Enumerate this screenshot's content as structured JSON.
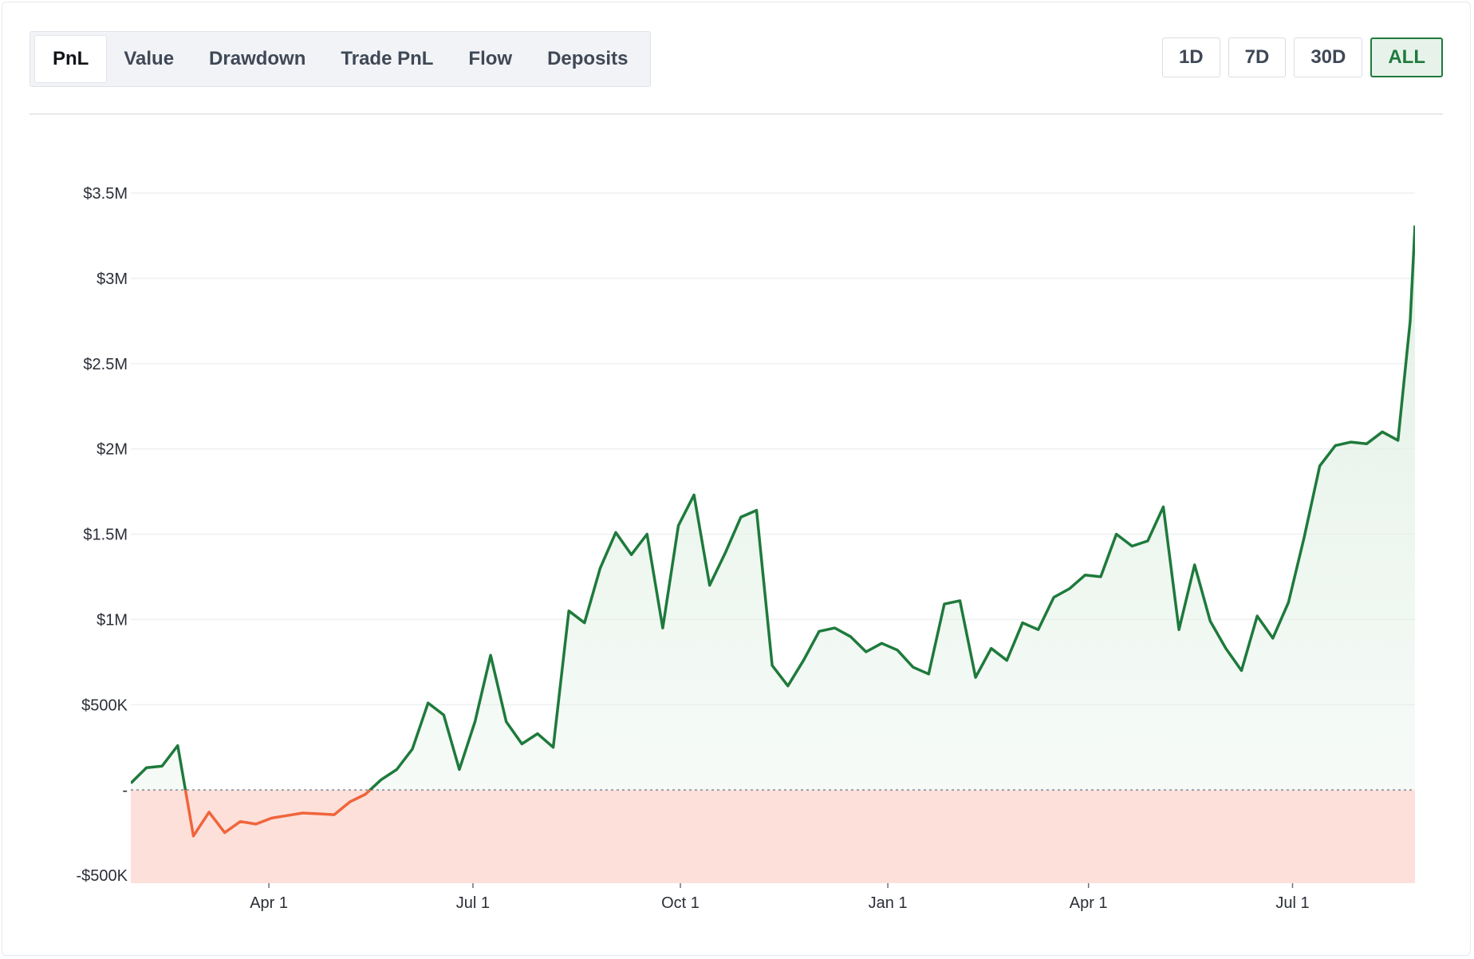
{
  "tabs": [
    {
      "label": "PnL",
      "active": true
    },
    {
      "label": "Value",
      "active": false
    },
    {
      "label": "Drawdown",
      "active": false
    },
    {
      "label": "Trade PnL",
      "active": false
    },
    {
      "label": "Flow",
      "active": false
    },
    {
      "label": "Deposits",
      "active": false
    }
  ],
  "ranges": [
    {
      "label": "1D",
      "active": false
    },
    {
      "label": "7D",
      "active": false
    },
    {
      "label": "30D",
      "active": false
    },
    {
      "label": "ALL",
      "active": true
    }
  ],
  "colors": {
    "positive_line": "#1e7a3c",
    "negative_line": "#f0643c",
    "positive_fill": "#e3f1e6",
    "negative_fill": "#fde0da",
    "grid": "#eef0f2"
  },
  "chart_data": {
    "type": "line",
    "ylim": [
      -500000,
      3500000
    ],
    "yticks": [
      {
        "value": 3500000,
        "label": "$3.5M"
      },
      {
        "value": 3000000,
        "label": "$3M"
      },
      {
        "value": 2500000,
        "label": "$2.5M"
      },
      {
        "value": 2000000,
        "label": "$2M"
      },
      {
        "value": 1500000,
        "label": "$1.5M"
      },
      {
        "value": 1000000,
        "label": "$1M"
      },
      {
        "value": 500000,
        "label": "$500K"
      },
      {
        "value": 0,
        "label": "-"
      },
      {
        "value": -500000,
        "label": "-$500K"
      }
    ],
    "xticks": [
      {
        "value": 1.0,
        "label": "Apr 1"
      },
      {
        "value": 4.0,
        "label": "Jul 1"
      },
      {
        "value": 7.05,
        "label": "Oct 1"
      },
      {
        "value": 10.1,
        "label": "Jan 1"
      },
      {
        "value": 13.05,
        "label": "Apr 1"
      },
      {
        "value": 16.05,
        "label": "Jul 1"
      }
    ],
    "xlim": [
      -1.03,
      17.85
    ],
    "x": [
      -1.03,
      -0.8,
      -0.57,
      -0.34,
      -0.11,
      0.12,
      0.35,
      0.58,
      0.81,
      1.04,
      1.27,
      1.5,
      1.73,
      1.96,
      2.19,
      2.42,
      2.65,
      2.88,
      3.11,
      3.34,
      3.57,
      3.8,
      4.03,
      4.26,
      4.49,
      4.72,
      4.95,
      5.18,
      5.41,
      5.64,
      5.87,
      6.1,
      6.33,
      6.56,
      6.79,
      7.02,
      7.25,
      7.48,
      7.71,
      7.94,
      8.17,
      8.4,
      8.63,
      8.86,
      9.09,
      9.32,
      9.55,
      9.78,
      10.01,
      10.24,
      10.47,
      10.7,
      10.93,
      11.16,
      11.39,
      11.62,
      11.85,
      12.08,
      12.31,
      12.54,
      12.77,
      13.0,
      13.23,
      13.46,
      13.69,
      13.92,
      14.15,
      14.38,
      14.61,
      14.84,
      15.07,
      15.3,
      15.53,
      15.76,
      15.99,
      16.22,
      16.45,
      16.68,
      16.91,
      17.14,
      17.37,
      17.6,
      17.78,
      17.85
    ],
    "values": [
      40000,
      130000,
      140000,
      260000,
      -270000,
      -130000,
      -250000,
      -185000,
      -200000,
      -165000,
      -150000,
      -135000,
      -140000,
      -145000,
      -70000,
      -25000,
      60000,
      120000,
      240000,
      510000,
      440000,
      120000,
      400000,
      790000,
      400000,
      270000,
      330000,
      250000,
      1050000,
      980000,
      1300000,
      1510000,
      1380000,
      1500000,
      950000,
      1550000,
      1730000,
      1200000,
      1390000,
      1600000,
      1640000,
      730000,
      610000,
      760000,
      930000,
      950000,
      900000,
      810000,
      860000,
      820000,
      720000,
      680000,
      1090000,
      1110000,
      660000,
      830000,
      760000,
      980000,
      940000,
      1130000,
      1180000,
      1260000,
      1250000,
      1500000,
      1430000,
      1460000,
      1660000,
      940000,
      1320000,
      990000,
      830000,
      700000,
      1020000,
      890000,
      1100000,
      1480000,
      1900000,
      2020000,
      2040000,
      2030000,
      2100000,
      2050000,
      2750000,
      3310000
    ]
  }
}
